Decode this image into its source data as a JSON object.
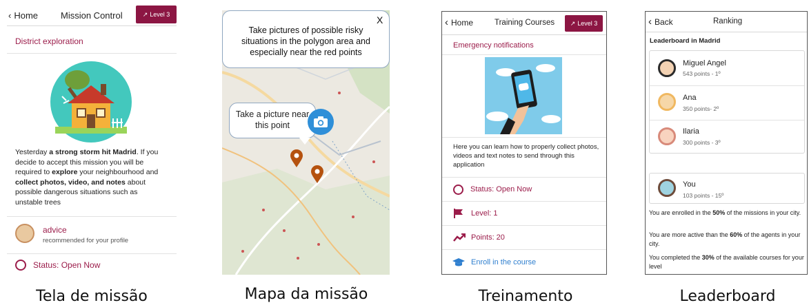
{
  "screen1": {
    "back_label": "Home",
    "title": "Mission Control",
    "level_label": "Level 3",
    "section_title": "District exploration",
    "description": [
      {
        "t": "Yesterday ",
        "b": false
      },
      {
        "t": "a strong storm hit Madrid",
        "b": true
      },
      {
        "t": ". If you decide to accept this mission you will be required to ",
        "b": false
      },
      {
        "t": "explore",
        "b": true
      },
      {
        "t": " your neighbourhood and ",
        "b": false
      },
      {
        "t": "collect photos, video, and notes",
        "b": true
      },
      {
        "t": " about possible dangerous situations such as unstable trees",
        "b": false
      }
    ],
    "advice_title": "advice",
    "advice_sub": "recommended for your profile",
    "status": "Status: Open Now",
    "caption": "Tela de missão"
  },
  "screen2": {
    "close_label": "X",
    "tooltip_text": "Take pictures of possible risky situations in the polygon area and especially near the red points",
    "bubble_text": "Take a picture near this point",
    "caption": "Mapa da missão"
  },
  "screen3": {
    "back_label": "Home",
    "title": "Training Courses",
    "level_label": "Level 3",
    "section_title": "Emergency notifications",
    "description": "Here you can learn how to properly collect photos, videos and text notes to send through this application",
    "status": "Status: Open Now",
    "level": "Level: 1",
    "points": "Points: 20",
    "enroll": "Enroll in the course",
    "caption": "Treinamento"
  },
  "screen4": {
    "back_label": "Back",
    "title": "Ranking",
    "leaderboard_title": "Leaderboard in Madrid",
    "entries": [
      {
        "name": "Miguel Angel",
        "points": "543 points - 1º"
      },
      {
        "name": "Ana",
        "points": "350 points- 2º"
      },
      {
        "name": "Ilaria",
        "points": "300 points - 3º"
      }
    ],
    "you": {
      "name": "You",
      "points": "103 points - 15º"
    },
    "stats": [
      [
        {
          "t": "You are enrolled in the ",
          "b": false
        },
        {
          "t": "50%",
          "b": true
        },
        {
          "t": " of the missions in your city.",
          "b": false
        }
      ],
      [
        {
          "t": "You are more active than the ",
          "b": false
        },
        {
          "t": "60%",
          "b": true
        },
        {
          "t": " of the agents in your city.",
          "b": false
        }
      ],
      [
        {
          "t": "You completed the ",
          "b": false
        },
        {
          "t": "30%",
          "b": true
        },
        {
          "t": " of the available courses for your level",
          "b": false
        }
      ]
    ],
    "caption": "Leaderboard"
  },
  "colors": {
    "accent": "#9b1c4a",
    "badge": "#8c1643",
    "link_blue": "#2f7fcf",
    "marker": "#b5520f"
  }
}
